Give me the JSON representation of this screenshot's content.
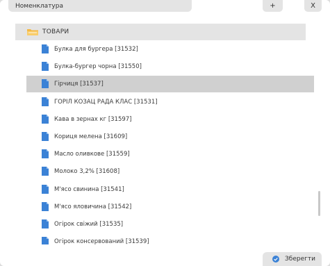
{
  "header": {
    "title": "Номенклатура",
    "add_label": "+",
    "close_label": "X"
  },
  "folder": {
    "label": "ТОВАРИ",
    "icon": "folder-icon",
    "color": "#f5b944"
  },
  "items": [
    {
      "label": "Булка для бургера [31532]",
      "selected": false
    },
    {
      "label": "Булка-бургер чорна [31550]",
      "selected": false
    },
    {
      "label": "Гірчиця [31537]",
      "selected": true
    },
    {
      "label": "ГОРІЛ КОЗАЦ РАДА КЛАС [31531]",
      "selected": false
    },
    {
      "label": "Кава в зернах кг [31597]",
      "selected": false
    },
    {
      "label": "Кориця мелена [31609]",
      "selected": false
    },
    {
      "label": "Масло оливкове [31559]",
      "selected": false
    },
    {
      "label": "Молоко 3,2% [31608]",
      "selected": false
    },
    {
      "label": "М'ясо свинина [31541]",
      "selected": false
    },
    {
      "label": "М'ясо яловичина [31542]",
      "selected": false
    },
    {
      "label": "Огірок свіжий [31535]",
      "selected": false
    },
    {
      "label": "Огірок консервований [31539]",
      "selected": false
    }
  ],
  "footer": {
    "save_label": "Зберегти"
  },
  "colors": {
    "doc_icon": "#3b82d6",
    "selected_row": "#d0d0d0",
    "bar_bg": "#e4e4e4"
  }
}
